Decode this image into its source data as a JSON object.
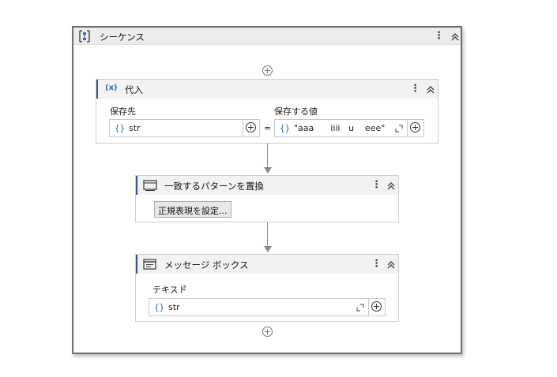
{
  "sequence": {
    "title": "シーケンス"
  },
  "assign": {
    "title": "代入",
    "to_label": "保存先",
    "to_value": "str",
    "eq": "=",
    "value_label": "保存する値",
    "value_value": "\"aaa      iiii   u    eee\""
  },
  "replace": {
    "title": "一致するパターンを置換",
    "regex_button": "正規表現を設定..."
  },
  "msgbox": {
    "title": "メッセージ ボックス",
    "text_label": "テキスト",
    "required": "*",
    "text_value": "str"
  },
  "icons": {
    "brace": "{}",
    "kebab": "⋮",
    "assign_icon": "(x)"
  },
  "colors": {
    "accent": "#2b5797",
    "brace": "#2b6cb0"
  }
}
